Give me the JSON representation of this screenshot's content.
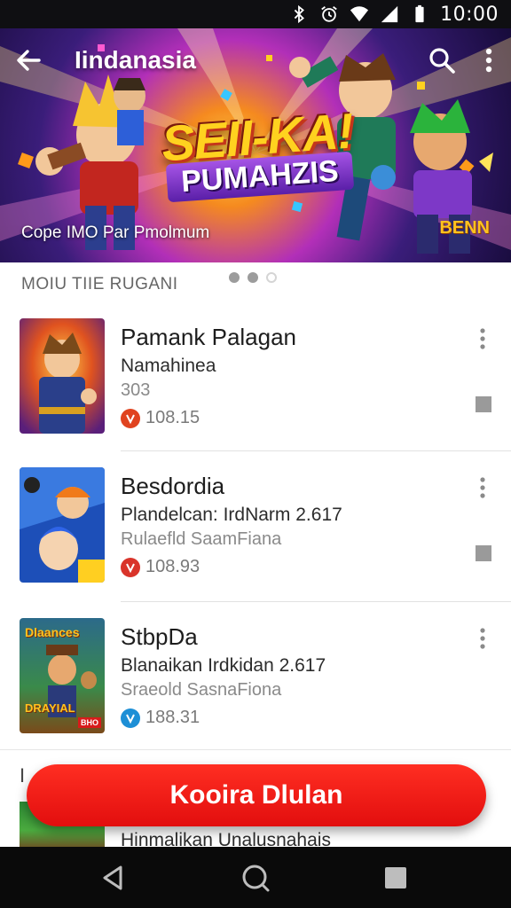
{
  "status_bar": {
    "time": "10:00"
  },
  "app_bar": {
    "title": "Iindanasia"
  },
  "hero": {
    "title": "SEII-KA!",
    "subtitle": "PUMAHZIS",
    "caption": "Cope IMO Par Pmolmum",
    "badge": "BENN"
  },
  "section": {
    "label": "MOIU TIIE RUGANI"
  },
  "games": [
    {
      "title": "Pamank Palagan",
      "line1": "Namahinea",
      "line2": "303",
      "price": "108.15",
      "price_icon_color": "#e0431f"
    },
    {
      "title": "Besdordia",
      "line1": "Plandelcan: IrdNarm 2.617",
      "line2": "Rulaefld SaamFiana",
      "price": "108.93",
      "price_icon_color": "#d9342a"
    },
    {
      "title": "StbpDa",
      "line1": "Blanaikan Irdkidan 2.617",
      "line2": "Sraeold SasnaFiona",
      "price": "188.31",
      "price_icon_color": "#1d8fd6"
    }
  ],
  "thumb_texts": {
    "game3_top": "Dlaances",
    "game3_bottom": "DRAYIAL",
    "game3_tag": "BHO"
  },
  "partial_item": {
    "letter": "I",
    "text": "Hinmalikan Unalusnahais"
  },
  "primary_button": {
    "label": "Kooira Dlulan"
  },
  "colors": {
    "accent": "#ee1a14",
    "status_bar": "#0f0f12",
    "nav_bar": "#0a0a0a"
  },
  "icons": {
    "back": "arrow-left-icon",
    "search": "search-icon",
    "menu": "more-vert-icon",
    "nav_back": "triangle-back-icon",
    "nav_home": "circle-home-icon",
    "nav_recents": "square-recents-icon"
  }
}
